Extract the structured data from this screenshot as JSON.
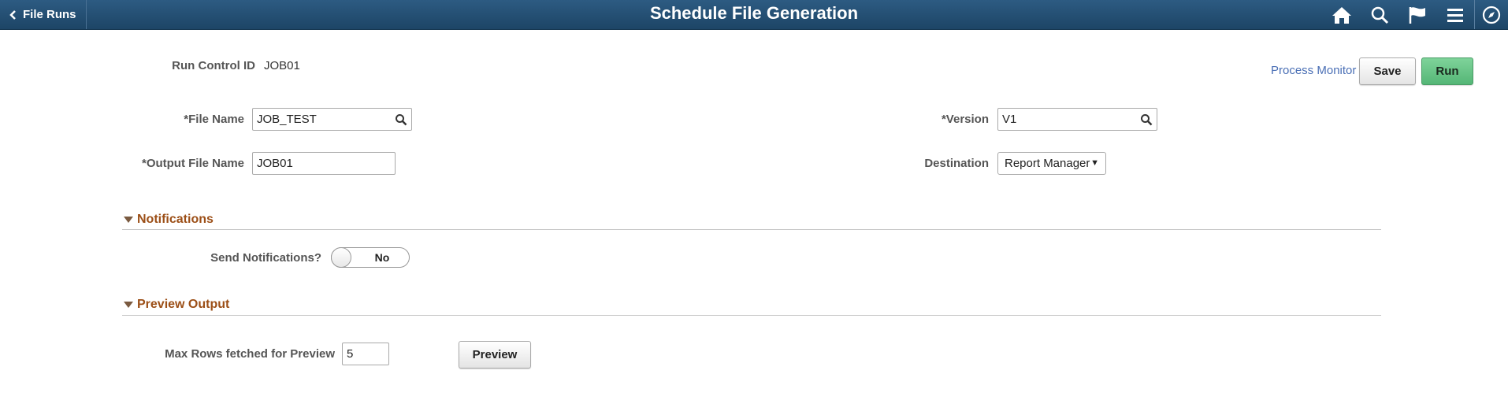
{
  "header": {
    "back_label": "File Runs",
    "title": "Schedule File Generation",
    "icons": [
      "home-icon",
      "search-icon",
      "flag-icon",
      "menu-icon",
      "compass-icon"
    ]
  },
  "form": {
    "run_control_label": "Run Control ID",
    "run_control_value": "JOB01",
    "file_name_label": "*File Name",
    "file_name_value": "JOB_TEST",
    "version_label": "*Version",
    "version_value": "V1",
    "output_file_label": "*Output File Name",
    "output_file_value": "JOB01",
    "destination_label": "Destination",
    "destination_value": "Report Manager"
  },
  "toolbar": {
    "process_monitor": "Process Monitor",
    "save": "Save",
    "run": "Run"
  },
  "notifications": {
    "title": "Notifications",
    "send_label": "Send Notifications?",
    "toggle_value": "No"
  },
  "preview": {
    "title": "Preview Output",
    "max_rows_label": "Max Rows fetched for Preview",
    "max_rows_value": "5",
    "button": "Preview"
  },
  "colors": {
    "header": "#2a5579",
    "section_title": "#9c4f17",
    "link": "#4a6fb5",
    "run_button": "#5fc07f"
  }
}
